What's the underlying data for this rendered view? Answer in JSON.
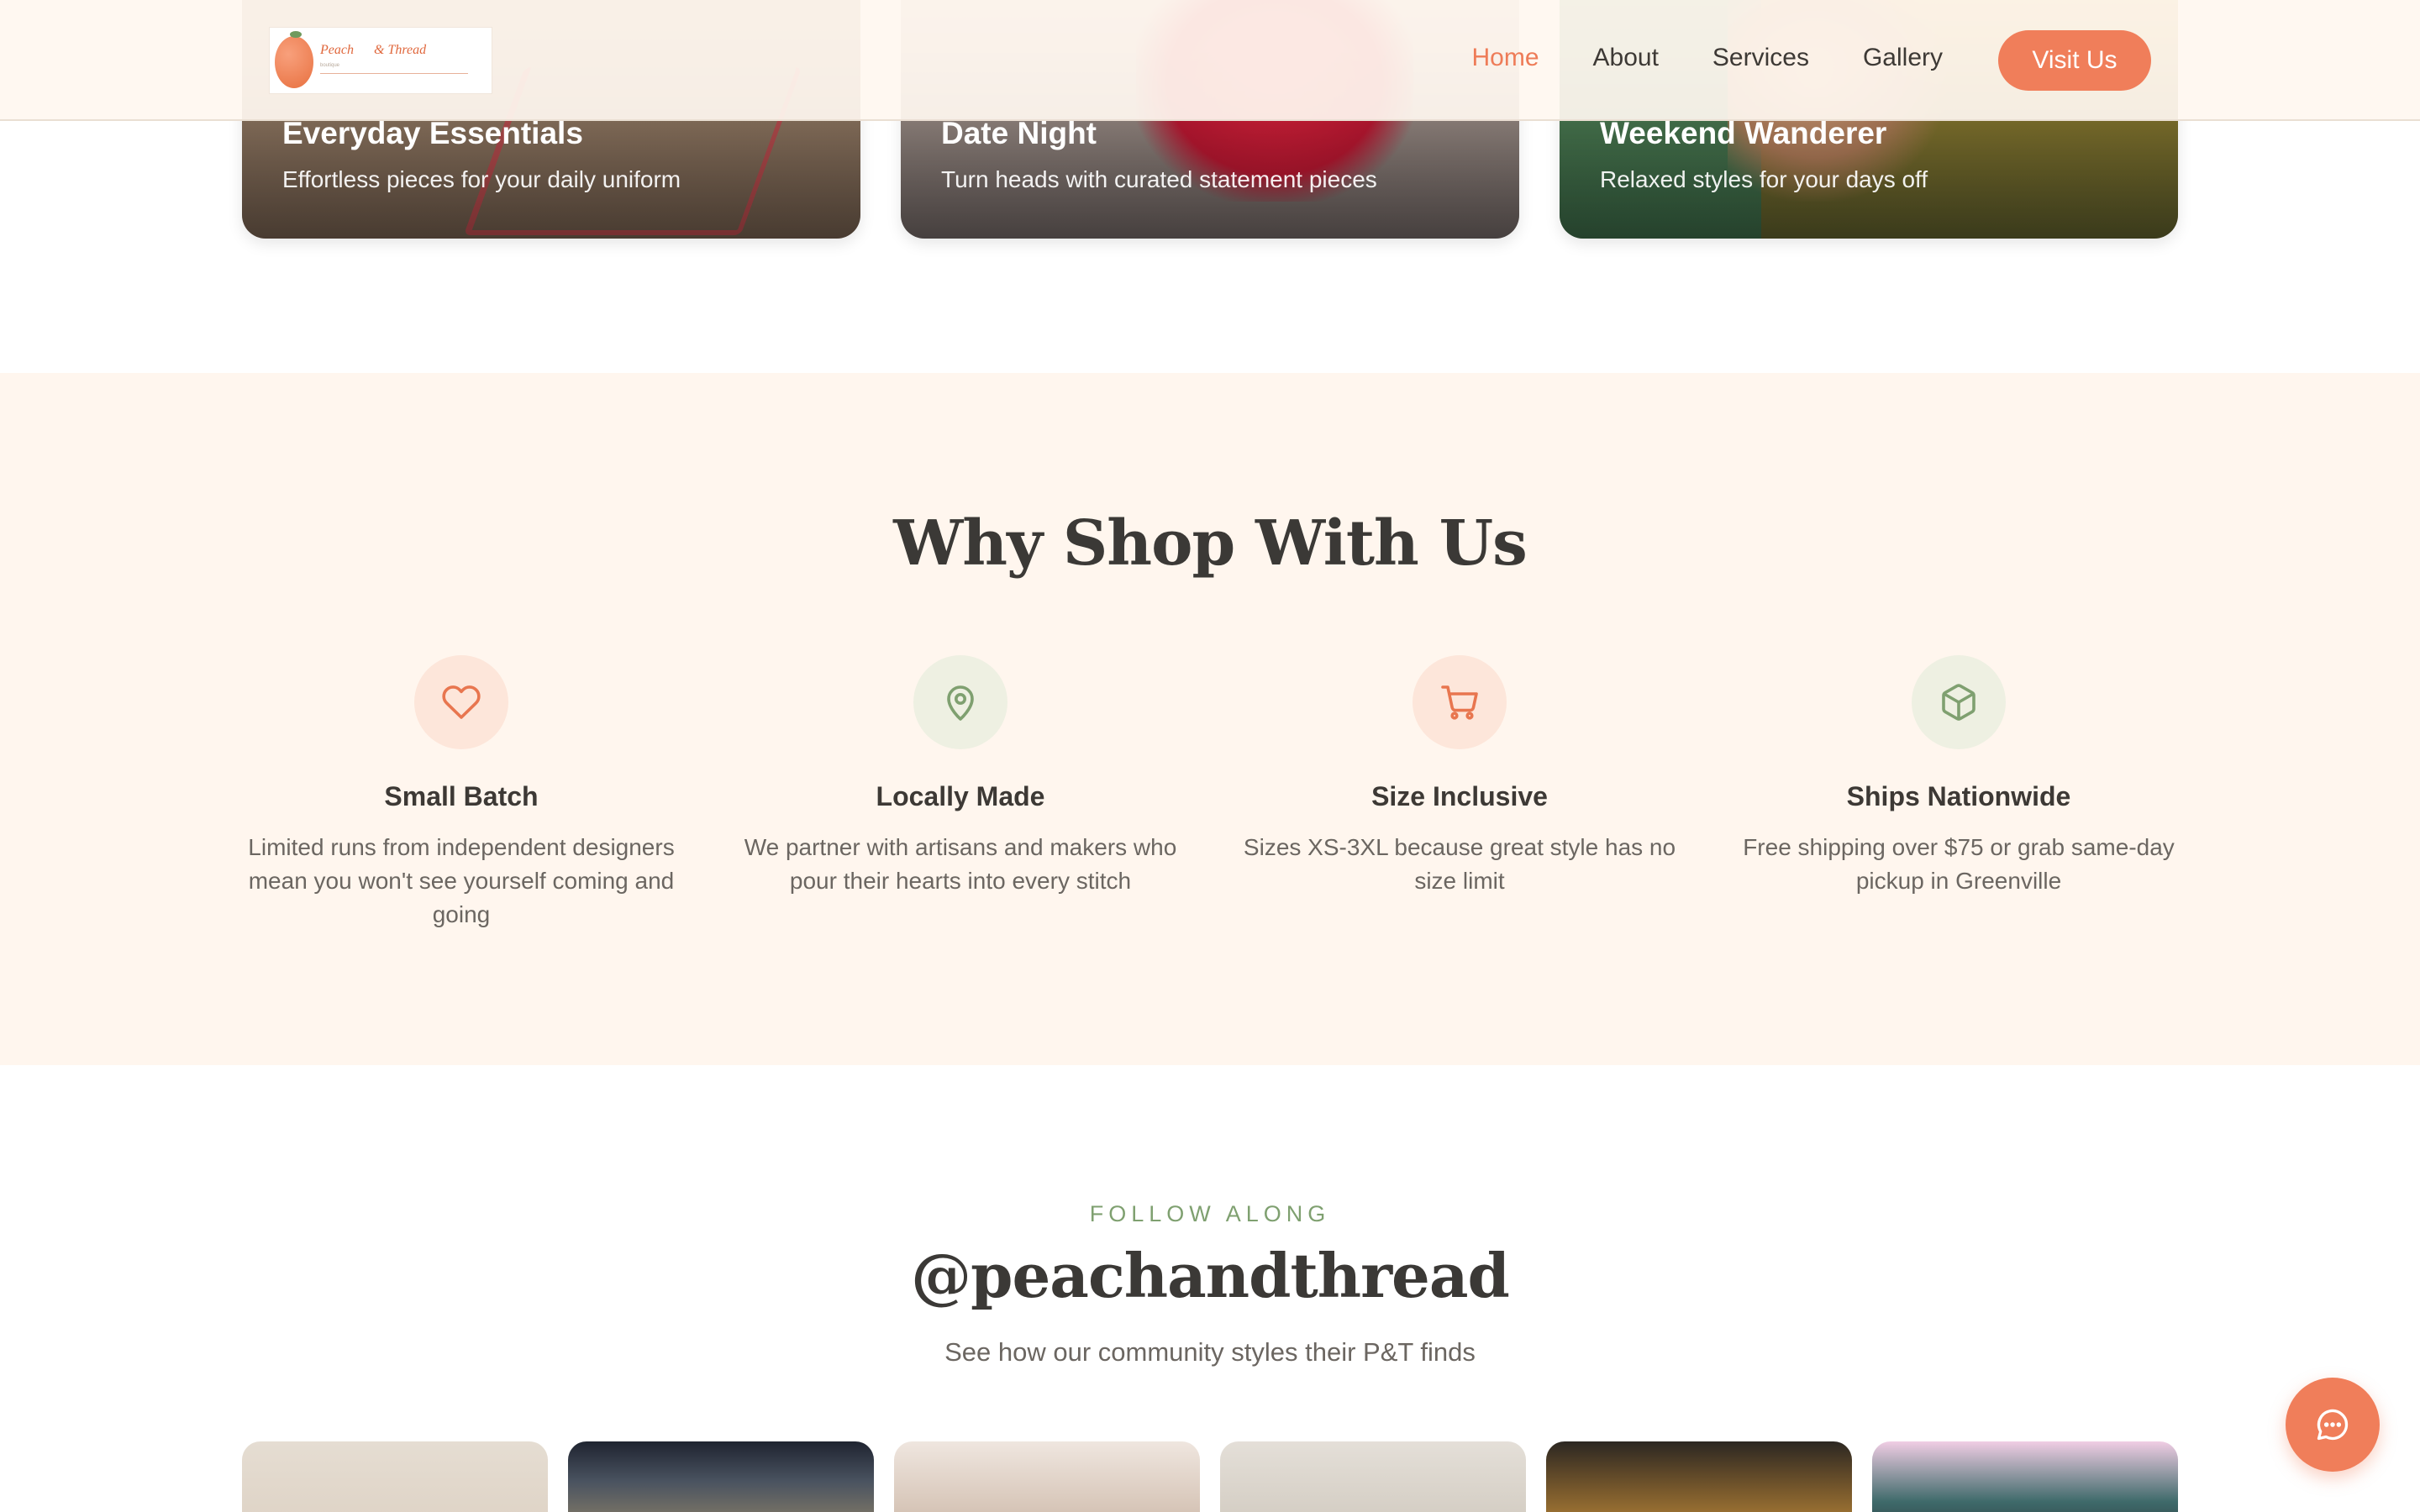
{
  "brand": {
    "logo_word_1": "Peach",
    "logo_word_2": "& Thread",
    "logo_tagline": "boutique"
  },
  "nav": {
    "items": [
      {
        "label": "Home",
        "active": true
      },
      {
        "label": "About",
        "active": false
      },
      {
        "label": "Services",
        "active": false
      },
      {
        "label": "Gallery",
        "active": false
      }
    ],
    "cta_label": "Visit Us"
  },
  "categories": [
    {
      "title": "Everyday Essentials",
      "subtitle": "Effortless pieces for your daily uniform"
    },
    {
      "title": "Date Night",
      "subtitle": "Turn heads with curated statement pieces"
    },
    {
      "title": "Weekend Wanderer",
      "subtitle": "Relaxed styles for your days off"
    }
  ],
  "why": {
    "title": "Why Shop With Us",
    "features": [
      {
        "icon": "heart-icon",
        "title": "Small Batch",
        "desc": "Limited runs from independent designers mean you won't see yourself coming and going"
      },
      {
        "icon": "map-pin-icon",
        "title": "Locally Made",
        "desc": "We partner with artisans and makers who pour their hearts into every stitch"
      },
      {
        "icon": "shopping-cart-icon",
        "title": "Size Inclusive",
        "desc": "Sizes XS-3XL because great style has no size limit"
      },
      {
        "icon": "package-icon",
        "title": "Ships Nationwide",
        "desc": "Free shipping over $75 or grab same-day pickup in Greenville"
      }
    ]
  },
  "follow": {
    "eyebrow": "FOLLOW ALONG",
    "handle": "@peachandthread",
    "subtitle": "See how our community styles their P&T finds"
  },
  "colors": {
    "accent": "#f07e5a",
    "green": "#7fa070",
    "section_bg": "#fff6ee",
    "text": "#3d3935"
  }
}
